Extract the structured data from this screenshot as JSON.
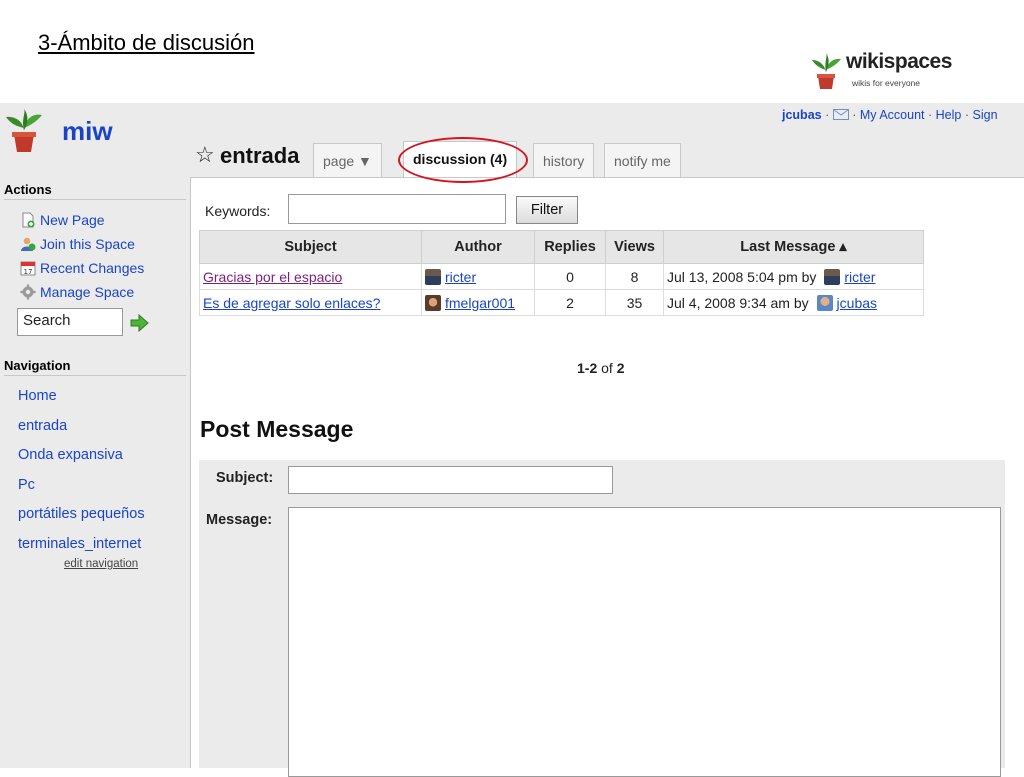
{
  "slide_title": "3-Ámbito de discusión",
  "wikispaces_logo": {
    "brand": "wikispaces",
    "tagline": "wikis for everyone"
  },
  "space": {
    "name": "miw"
  },
  "user_links": {
    "user": "jcubas",
    "my_account": "My Account",
    "help": "Help",
    "sign": "Sign"
  },
  "actions": {
    "title": "Actions",
    "items": [
      {
        "label": "New Page",
        "icon": "new-page-icon"
      },
      {
        "label": "Join this Space",
        "icon": "join-icon"
      },
      {
        "label": "Recent Changes",
        "icon": "calendar-icon"
      },
      {
        "label": "Manage Space",
        "icon": "gear-icon"
      }
    ],
    "search_value": "Search"
  },
  "navigation": {
    "title": "Navigation",
    "items": [
      "Home",
      "entrada",
      "Onda expansiva",
      "Pc",
      "portátiles pequeños",
      "terminales_internet"
    ],
    "edit_label": "edit navigation"
  },
  "page": {
    "title": "entrada",
    "tabs": [
      {
        "label": "page ▼",
        "active": false
      },
      {
        "label": "discussion (4)",
        "active": true
      },
      {
        "label": "history",
        "active": false
      },
      {
        "label": "notify me",
        "active": false
      }
    ]
  },
  "filter": {
    "keywords_label": "Keywords:",
    "keywords_value": "",
    "button_label": "Filter"
  },
  "threads": {
    "headers": {
      "subject": "Subject",
      "author": "Author",
      "replies": "Replies",
      "views": "Views",
      "last_message": "Last Message ▴"
    },
    "rows": [
      {
        "subject": "Gracias por el espacio",
        "author": "ricter",
        "replies": "0",
        "views": "8",
        "last_message": "Jul 13, 2008 5:04 pm by",
        "last_user": "ricter"
      },
      {
        "subject": "Es de agregar solo enlaces?",
        "author": "fmelgar001",
        "replies": "2",
        "views": "35",
        "last_message": "Jul 4, 2008 9:34 am by",
        "last_user": "jcubas"
      }
    ]
  },
  "pager": {
    "range": "1-2",
    "of_label": "of",
    "total": "2"
  },
  "post": {
    "heading": "Post Message",
    "subject_label": "Subject:",
    "message_label": "Message:"
  },
  "colors": {
    "link": "#1a44c8",
    "visited": "#7b1f7a",
    "highlight_circle": "#d4141e"
  }
}
